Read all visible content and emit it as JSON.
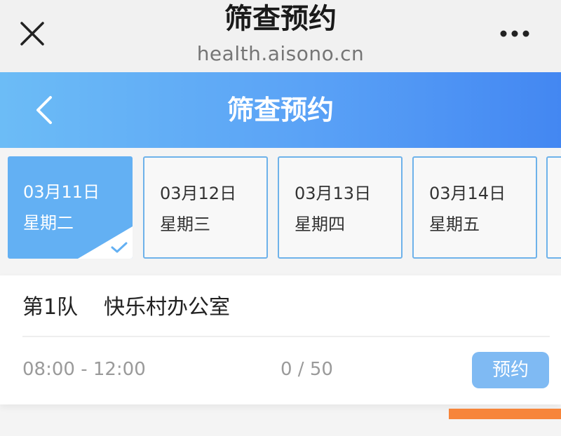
{
  "browser": {
    "title": "筛查预约",
    "url": "health.aisono.cn"
  },
  "header": {
    "title": "筛查预约"
  },
  "dates": [
    {
      "date": "03月11日",
      "weekday": "星期二",
      "selected": true
    },
    {
      "date": "03月12日",
      "weekday": "星期三",
      "selected": false
    },
    {
      "date": "03月13日",
      "weekday": "星期四",
      "selected": false
    },
    {
      "date": "03月14日",
      "weekday": "星期五",
      "selected": false
    }
  ],
  "session": {
    "team": "第1队",
    "location": "快乐村办公室",
    "time_range": "08:00 - 12:00",
    "capacity": "0 / 50",
    "book_label": "预约"
  },
  "colors": {
    "header_start": "#6cbcf6",
    "header_end": "#4387f2",
    "selected_card": "#63b0f3",
    "card_border": "#6eb2ea",
    "book_button": "#7fbaf3",
    "accent_orange": "#f7853a"
  },
  "icons": {
    "close": "close-icon",
    "more": "more-icon",
    "back": "chevron-left-icon",
    "check": "check-icon"
  }
}
